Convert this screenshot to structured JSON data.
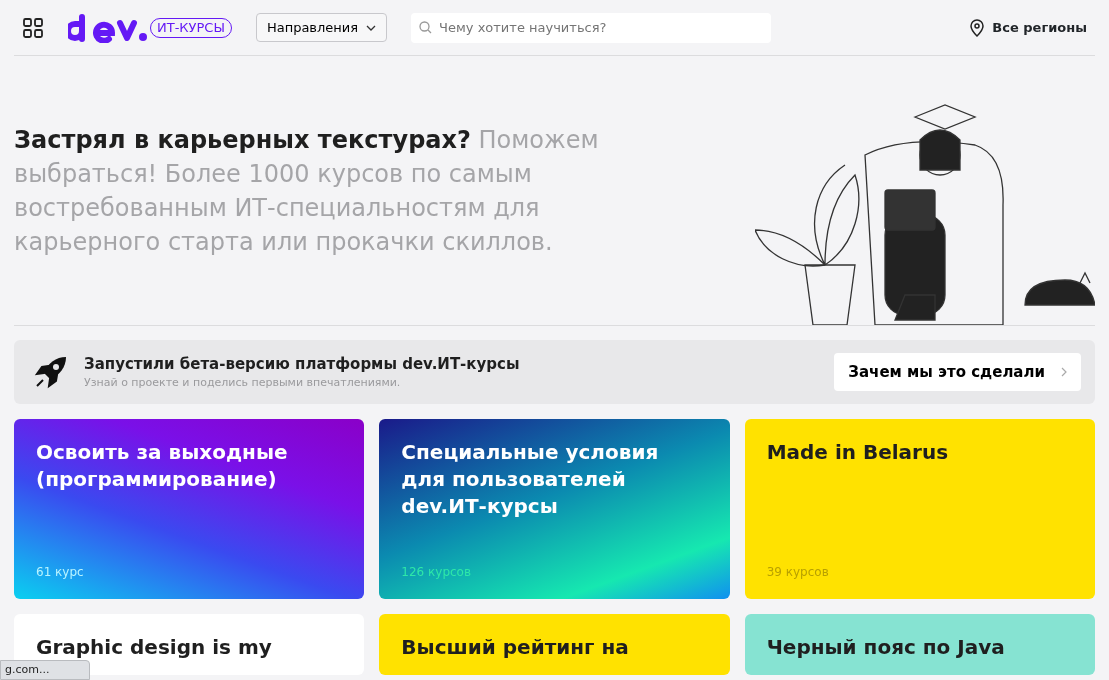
{
  "header": {
    "logo_badge": "ИТ-КУРСЫ",
    "directions_button": "Направления",
    "search": {
      "placeholder": "Чему хотите научиться?"
    },
    "region": "Все регионы"
  },
  "hero": {
    "title_bold": "Застрял в карьерных текстурах?",
    "title_rest": "Поможем выбраться! Более 1000 курсов по самым востребованным ИТ-специальностям для карьерного старта или прокачки скиллов."
  },
  "beta_banner": {
    "title": "Запустили бета-версию платформы dev.ИТ-курсы",
    "subtitle": "Узнай о проекте и поделись первыми впечатлениями.",
    "button": "Зачем мы это сделали"
  },
  "collections": [
    {
      "kind": "violet",
      "title": "Освоить за выходные (программирование)",
      "count": "61 курс"
    },
    {
      "kind": "ocean",
      "title": "Специальные условия для пользователей dev.ИТ-курсы",
      "count": "126 курсов"
    },
    {
      "kind": "yellow",
      "title": "Made in Belarus",
      "count": "39 курсов"
    },
    {
      "kind": "white",
      "title": "Graphic design is my"
    },
    {
      "kind": "yellow",
      "title": "Высший рейтинг на"
    },
    {
      "kind": "mint",
      "title": "Черный пояс по Java"
    }
  ],
  "status_tooltip": "g.com..."
}
